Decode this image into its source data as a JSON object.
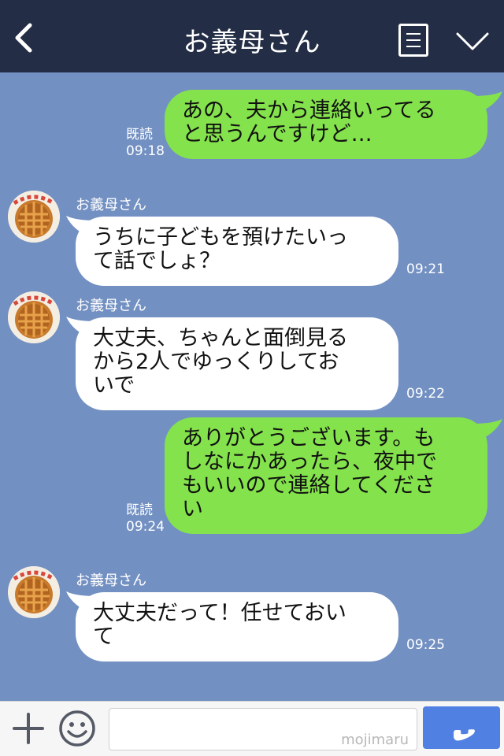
{
  "header": {
    "title": "お義母さん"
  },
  "messages": [
    {
      "direction": "out",
      "lines": [
        "あの、夫から連絡いってる",
        "と思うんですけど…"
      ],
      "read": "既読",
      "time": "09:18"
    },
    {
      "direction": "in",
      "sender": "お義母さん",
      "lines": [
        "うちに子どもを預けたいっ",
        "て話でしょ？"
      ],
      "time": "09:21"
    },
    {
      "direction": "in",
      "sender": "お義母さん",
      "lines": [
        "大丈夫、ちゃんと面倒見る",
        "から2人でゆっくりしてお",
        "いで"
      ],
      "time": "09:22"
    },
    {
      "direction": "out",
      "lines": [
        "ありがとうございます。も",
        "しなにかあったら、夜中で",
        "もいいので連絡してくださ",
        "い"
      ],
      "read": "既読",
      "time": "09:24"
    },
    {
      "direction": "in",
      "sender": "お義母さん",
      "lines": [
        "大丈夫だって！任せておい",
        "て"
      ],
      "time": "09:25"
    }
  ],
  "footer": {
    "watermark": "mojimaru"
  },
  "colors": {
    "header_bg": "#232d45",
    "chat_bg": "#7290c2",
    "outgoing_bubble": "#84e24c",
    "incoming_bubble": "#ffffff",
    "send_button": "#4f80e2"
  },
  "icons": {
    "back": "back-arrow-icon",
    "menu": "menu-icon",
    "collapse": "chevron-down-icon",
    "plus": "plus-icon",
    "emoji": "smiley-icon",
    "send": "phone-icon",
    "avatar": "pie-avatar-icon"
  }
}
